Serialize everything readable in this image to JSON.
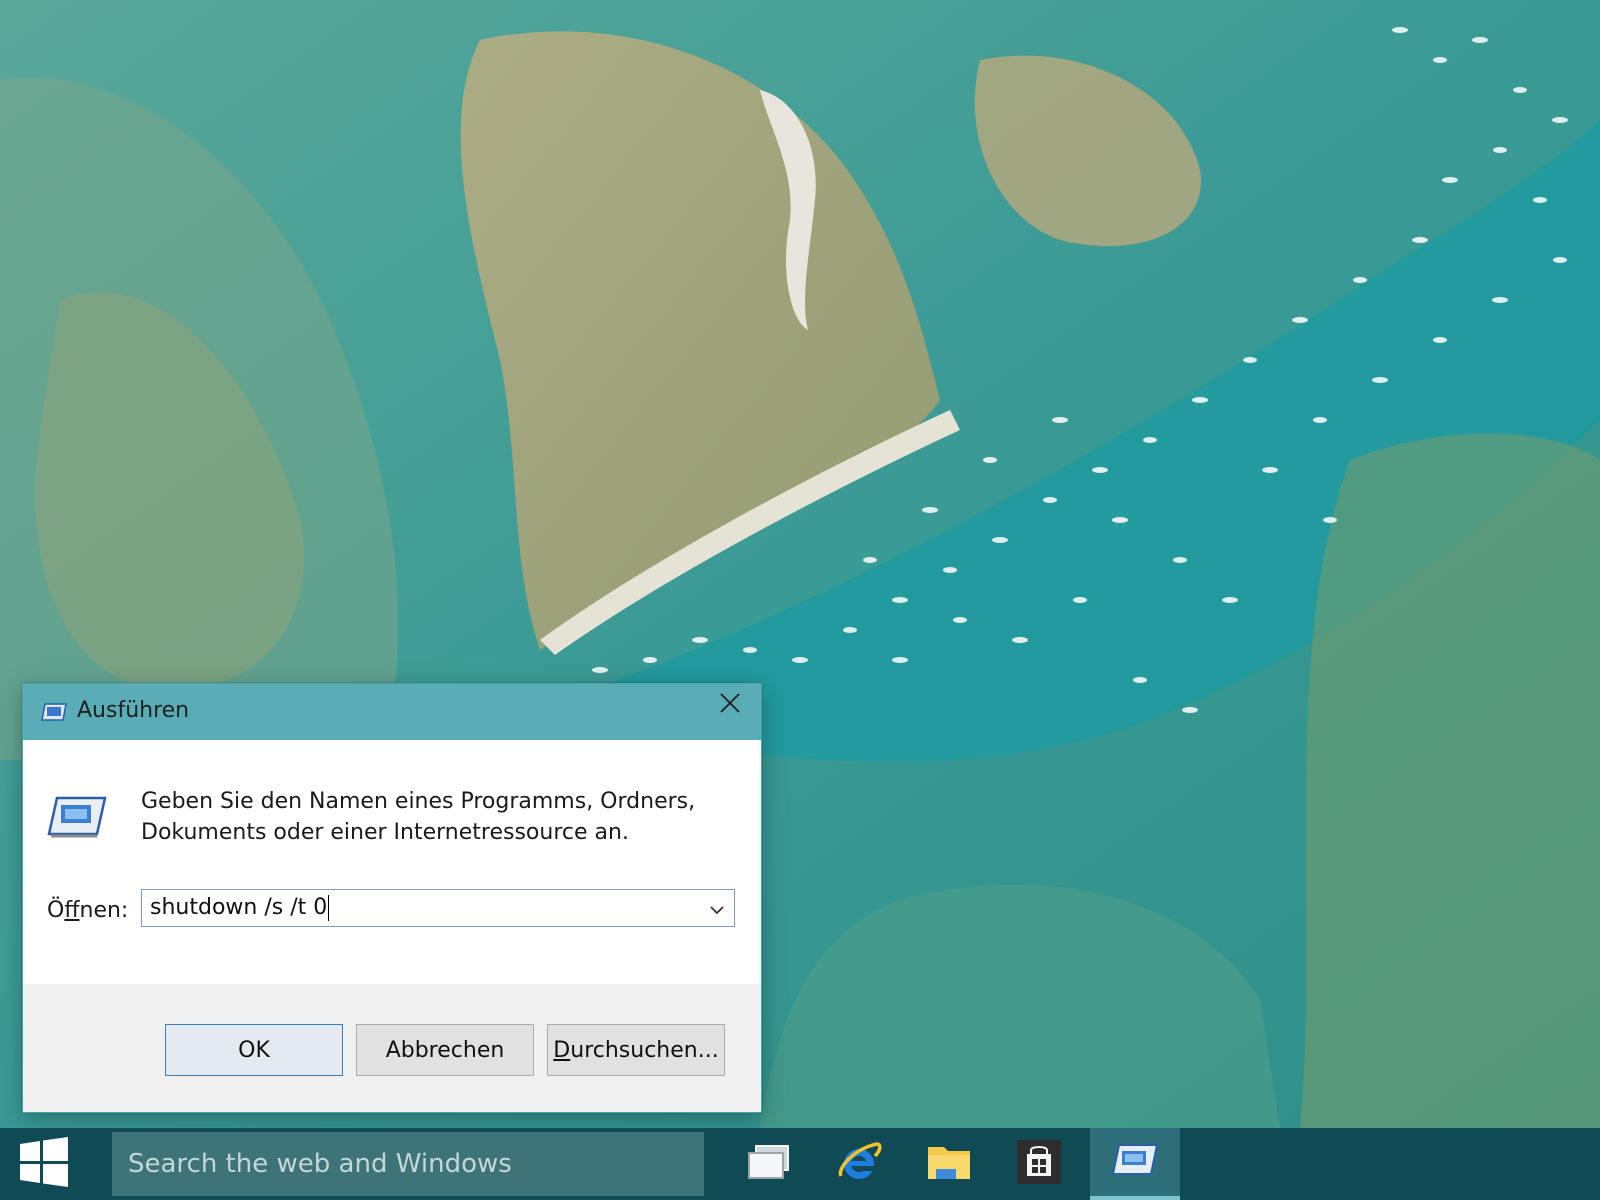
{
  "dialog": {
    "title": "Ausführen",
    "description_line1": "Geben Sie den Namen eines Programms, Ordners,",
    "description_line2": "Dokuments oder einer Internetressource an.",
    "open_label_prefix": "Ö",
    "open_label_accel": "f",
    "open_label_suffix": "fnen:",
    "command_value": "shutdown /s /t 0",
    "ok_label": "OK",
    "cancel_label": "Abbrechen",
    "browse_label_accel": "D",
    "browse_label_rest": "urchsuchen...",
    "icons": {
      "title": "run-icon",
      "body": "run-icon",
      "close": "close-icon",
      "dropdown": "chevron-down-icon"
    }
  },
  "taskbar": {
    "search_placeholder": "Search the web and Windows",
    "items": [
      {
        "name": "task-view",
        "icon": "task-view-icon"
      },
      {
        "name": "internet-explorer",
        "icon": "internet-explorer-icon"
      },
      {
        "name": "file-explorer",
        "icon": "folder-icon"
      },
      {
        "name": "store",
        "icon": "store-icon"
      },
      {
        "name": "run",
        "icon": "run-icon",
        "active": true
      }
    ]
  },
  "colors": {
    "titlebar": "#5aacb6",
    "taskbar": "#0f4a55",
    "search_box": "#3e7377",
    "dialog_footer": "#f0f0f0"
  }
}
